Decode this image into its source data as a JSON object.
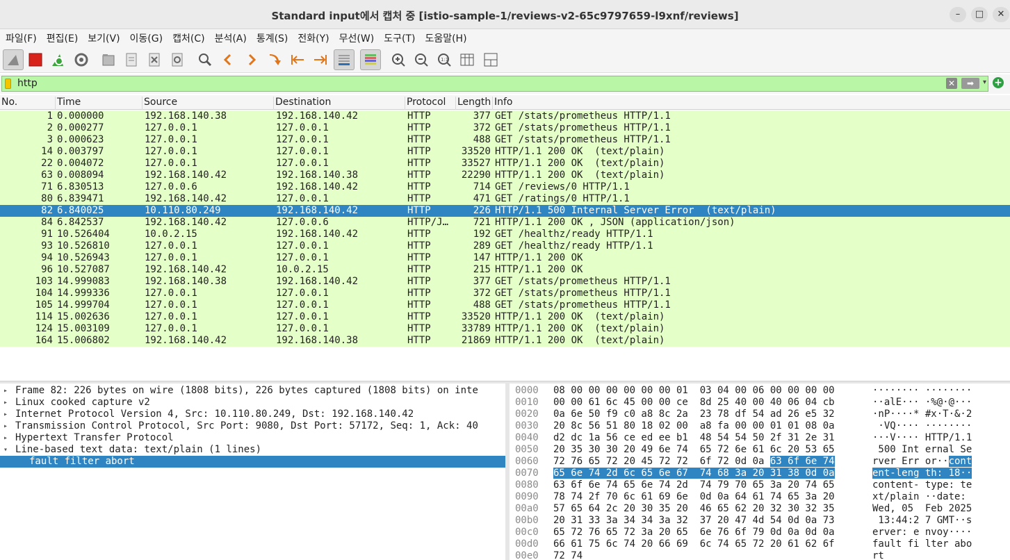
{
  "window": {
    "title": "Standard input에서 캡처 중 [istio-sample-1/reviews-v2-65c9797659-l9xnf/reviews]",
    "minimize_label": "–",
    "maximize_label": "□",
    "close_label": "✕"
  },
  "menu": [
    "파일(F)",
    "편집(E)",
    "보기(V)",
    "이동(G)",
    "캡처(C)",
    "분석(A)",
    "통계(S)",
    "전화(Y)",
    "무선(W)",
    "도구(T)",
    "도움말(H)"
  ],
  "toolbar": {
    "icons": [
      "shark-fin-icon",
      "stop-capture-icon",
      "restart-capture-icon",
      "capture-options-icon",
      "open-file-icon",
      "save-file-icon",
      "close-file-icon",
      "reload-file-icon",
      "find-packet-icon",
      "go-back-icon",
      "go-forward-icon",
      "go-to-packet-icon",
      "go-first-icon",
      "go-last-icon",
      "auto-scroll-icon",
      "colorize-icon",
      "zoom-in-icon",
      "zoom-out-icon",
      "normal-size-icon",
      "resize-columns-icon",
      "layout-icon"
    ]
  },
  "filter": {
    "value": "http",
    "clear_label": "✕",
    "apply_label": "➡",
    "add_label": "+"
  },
  "packet_list": {
    "columns": [
      "No.",
      "Time",
      "Source",
      "Destination",
      "Protocol",
      "Length",
      "Info"
    ],
    "selected_index": 8,
    "rows": [
      {
        "no": "1",
        "time": "0.000000",
        "src": "192.168.140.38",
        "dst": "192.168.140.42",
        "proto": "HTTP",
        "len": "377",
        "info": "GET /stats/prometheus HTTP/1.1"
      },
      {
        "no": "2",
        "time": "0.000277",
        "src": "127.0.0.1",
        "dst": "127.0.0.1",
        "proto": "HTTP",
        "len": "372",
        "info": "GET /stats/prometheus HTTP/1.1"
      },
      {
        "no": "3",
        "time": "0.000623",
        "src": "127.0.0.1",
        "dst": "127.0.0.1",
        "proto": "HTTP",
        "len": "488",
        "info": "GET /stats/prometheus HTTP/1.1"
      },
      {
        "no": "14",
        "time": "0.003797",
        "src": "127.0.0.1",
        "dst": "127.0.0.1",
        "proto": "HTTP",
        "len": "33520",
        "info": "HTTP/1.1 200 OK  (text/plain)"
      },
      {
        "no": "22",
        "time": "0.004072",
        "src": "127.0.0.1",
        "dst": "127.0.0.1",
        "proto": "HTTP",
        "len": "33527",
        "info": "HTTP/1.1 200 OK  (text/plain)"
      },
      {
        "no": "63",
        "time": "0.008094",
        "src": "192.168.140.42",
        "dst": "192.168.140.38",
        "proto": "HTTP",
        "len": "22290",
        "info": "HTTP/1.1 200 OK  (text/plain)"
      },
      {
        "no": "71",
        "time": "6.830513",
        "src": "127.0.0.6",
        "dst": "192.168.140.42",
        "proto": "HTTP",
        "len": "714",
        "info": "GET /reviews/0 HTTP/1.1"
      },
      {
        "no": "80",
        "time": "6.839471",
        "src": "192.168.140.42",
        "dst": "127.0.0.1",
        "proto": "HTTP",
        "len": "471",
        "info": "GET /ratings/0 HTTP/1.1"
      },
      {
        "no": "82",
        "time": "6.840025",
        "src": "10.110.80.249",
        "dst": "192.168.140.42",
        "proto": "HTTP",
        "len": "226",
        "info": "HTTP/1.1 500 Internal Server Error  (text/plain)"
      },
      {
        "no": "84",
        "time": "6.842537",
        "src": "192.168.140.42",
        "dst": "127.0.0.6",
        "proto": "HTTP/J…",
        "len": "721",
        "info": "HTTP/1.1 200 OK , JSON (application/json)"
      },
      {
        "no": "91",
        "time": "10.526404",
        "src": "10.0.2.15",
        "dst": "192.168.140.42",
        "proto": "HTTP",
        "len": "192",
        "info": "GET /healthz/ready HTTP/1.1"
      },
      {
        "no": "93",
        "time": "10.526810",
        "src": "127.0.0.1",
        "dst": "127.0.0.1",
        "proto": "HTTP",
        "len": "289",
        "info": "GET /healthz/ready HTTP/1.1"
      },
      {
        "no": "94",
        "time": "10.526943",
        "src": "127.0.0.1",
        "dst": "127.0.0.1",
        "proto": "HTTP",
        "len": "147",
        "info": "HTTP/1.1 200 OK"
      },
      {
        "no": "96",
        "time": "10.527087",
        "src": "192.168.140.42",
        "dst": "10.0.2.15",
        "proto": "HTTP",
        "len": "215",
        "info": "HTTP/1.1 200 OK"
      },
      {
        "no": "103",
        "time": "14.999083",
        "src": "192.168.140.38",
        "dst": "192.168.140.42",
        "proto": "HTTP",
        "len": "377",
        "info": "GET /stats/prometheus HTTP/1.1"
      },
      {
        "no": "104",
        "time": "14.999336",
        "src": "127.0.0.1",
        "dst": "127.0.0.1",
        "proto": "HTTP",
        "len": "372",
        "info": "GET /stats/prometheus HTTP/1.1"
      },
      {
        "no": "105",
        "time": "14.999704",
        "src": "127.0.0.1",
        "dst": "127.0.0.1",
        "proto": "HTTP",
        "len": "488",
        "info": "GET /stats/prometheus HTTP/1.1"
      },
      {
        "no": "114",
        "time": "15.002636",
        "src": "127.0.0.1",
        "dst": "127.0.0.1",
        "proto": "HTTP",
        "len": "33520",
        "info": "HTTP/1.1 200 OK  (text/plain)"
      },
      {
        "no": "124",
        "time": "15.003109",
        "src": "127.0.0.1",
        "dst": "127.0.0.1",
        "proto": "HTTP",
        "len": "33789",
        "info": "HTTP/1.1 200 OK  (text/plain)"
      },
      {
        "no": "164",
        "time": "15.006802",
        "src": "192.168.140.42",
        "dst": "192.168.140.38",
        "proto": "HTTP",
        "len": "21869",
        "info": "HTTP/1.1 200 OK  (text/plain)"
      }
    ]
  },
  "details": {
    "items": [
      {
        "arrow": "▸",
        "text": "Frame 82: 226 bytes on wire (1808 bits), 226 bytes captured (1808 bits) on inte"
      },
      {
        "arrow": "▸",
        "text": "Linux cooked capture v2"
      },
      {
        "arrow": "▸",
        "text": "Internet Protocol Version 4, Src: 10.110.80.249, Dst: 192.168.140.42"
      },
      {
        "arrow": "▸",
        "text": "Transmission Control Protocol, Src Port: 9080, Dst Port: 57172, Seq: 1, Ack: 40"
      },
      {
        "arrow": "▸",
        "text": "Hypertext Transfer Protocol"
      },
      {
        "arrow": "▾",
        "text": "Line-based text data: text/plain (1 lines)"
      },
      {
        "arrow": "",
        "text": "fault filter abort"
      }
    ]
  },
  "hex": {
    "rows": [
      {
        "off": "0000",
        "bytes": "08 00 00 00 00 00 00 01  03 04 00 06 00 00 00 00",
        "ascii": "········ ········"
      },
      {
        "off": "0010",
        "bytes": "00 00 61 6c 45 00 00 ce  8d 25 40 00 40 06 04 cb",
        "ascii": "··alE··· ·%@·@···"
      },
      {
        "off": "0020",
        "bytes": "0a 6e 50 f9 c0 a8 8c 2a  23 78 df 54 ad 26 e5 32",
        "ascii": "·nP····* #x·T·&·2"
      },
      {
        "off": "0030",
        "bytes": "20 8c 56 51 80 18 02 00  a8 fa 00 00 01 01 08 0a",
        "ascii": " ·VQ···· ········"
      },
      {
        "off": "0040",
        "bytes": "d2 dc 1a 56 ce ed ee b1  48 54 54 50 2f 31 2e 31",
        "ascii": "···V···· HTTP/1.1"
      },
      {
        "off": "0050",
        "bytes": "20 35 30 30 20 49 6e 74  65 72 6e 61 6c 20 53 65",
        "ascii": " 500 Int ernal Se"
      },
      {
        "off": "0060",
        "bytes": "72 76 65 72 20 45 72 72  6f 72 0d 0a 63 6f 6e 74",
        "ascii": "rver Err or··cont"
      },
      {
        "off": "0070",
        "bytes": "65 6e 74 2d 6c 65 6e 67  74 68 3a 20 31 38 0d 0a",
        "ascii": "ent-leng th: 18··"
      },
      {
        "off": "0080",
        "bytes": "63 6f 6e 74 65 6e 74 2d  74 79 70 65 3a 20 74 65",
        "ascii": "content- type: te"
      },
      {
        "off": "0090",
        "bytes": "78 74 2f 70 6c 61 69 6e  0d 0a 64 61 74 65 3a 20",
        "ascii": "xt/plain ··date: "
      },
      {
        "off": "00a0",
        "bytes": "57 65 64 2c 20 30 35 20  46 65 62 20 32 30 32 35",
        "ascii": "Wed, 05  Feb 2025"
      },
      {
        "off": "00b0",
        "bytes": "20 31 33 3a 34 34 3a 32  37 20 47 4d 54 0d 0a 73",
        "ascii": " 13:44:2 7 GMT··s"
      },
      {
        "off": "00c0",
        "bytes": "65 72 76 65 72 3a 20 65  6e 76 6f 79 0d 0a 0d 0a",
        "ascii": "erver: e nvoy····"
      },
      {
        "off": "00d0",
        "bytes": "66 61 75 6c 74 20 66 69  6c 74 65 72 20 61 62 6f",
        "ascii": "fault fi lter abo"
      },
      {
        "off": "00e0",
        "bytes": "72 74",
        "ascii": "rt"
      }
    ]
  },
  "colors": {
    "row_bg": "#e4ffc7",
    "selected": "#2f84c2",
    "filter_bg": "#b9f7a6"
  }
}
